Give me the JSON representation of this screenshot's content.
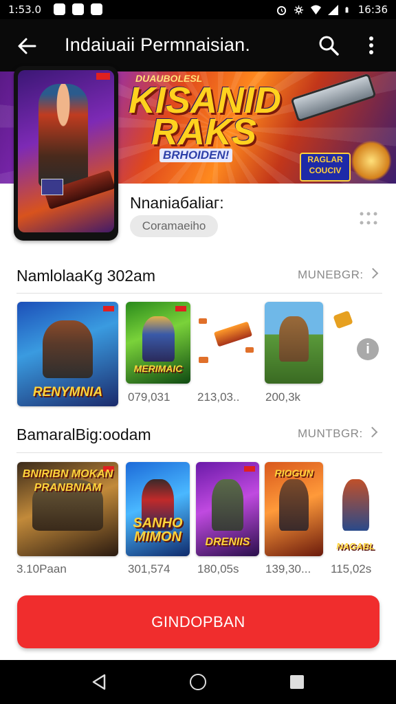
{
  "status_bar": {
    "time_left": "1:53.0",
    "time_right": "16:36",
    "left_icons": [
      "messenger-icon",
      "notification-icon",
      "heart-notification-icon"
    ],
    "right_icons": [
      "alarm-icon",
      "settings-icon",
      "wifi-icon",
      "signal-icon",
      "battery-icon"
    ]
  },
  "app_bar": {
    "title": "Indaiuaii Permnaisian.",
    "icons": [
      "back-arrow-icon",
      "search-icon",
      "more-vert-icon"
    ]
  },
  "hero": {
    "tagline": "DUAUBOLESL",
    "headline_1": "KISANID",
    "headline_2": "RAKS",
    "subline": "BRHOIDEN!",
    "badge": "RAGLAR COUCIV"
  },
  "app_info": {
    "name": "Nnaniaбaliaг:",
    "chip": "Coramaeiho"
  },
  "section1": {
    "title": "NamlolaaKg 302am",
    "more": "MUNEBGR:",
    "items": [
      {
        "caption": "RENYMNIA",
        "number": "079,031"
      },
      {
        "caption": "MERIMAIC",
        "number": "213,03.."
      },
      {
        "caption": "",
        "number": ""
      },
      {
        "caption": "",
        "number": "200,3k"
      }
    ],
    "side_icon": "info-icon",
    "side_glyph": "i"
  },
  "section2": {
    "title": "BamaralBig:oodam",
    "more": "MUNTBGR:",
    "items": [
      {
        "caption": "BNIRIBN MOKAN PRANBNIAM",
        "number": "3.10Paan"
      },
      {
        "caption": "SANHO MIMON",
        "number": "301,574"
      },
      {
        "caption": "DRENIIS",
        "number": "180,05s"
      },
      {
        "caption": "RIOGUN",
        "number": "139,30..."
      },
      {
        "caption": "NAGABL",
        "number": "115,02s"
      }
    ]
  },
  "cta": {
    "label": "GINDOPBAN"
  },
  "nav_bar": {
    "icons": [
      "nav-back-icon",
      "nav-home-icon",
      "nav-recents-icon"
    ]
  },
  "colors": {
    "accent": "#f02d2d",
    "app_bar": "#0a0a0a",
    "text_primary": "#111111",
    "text_secondary": "#8a8a8a"
  }
}
